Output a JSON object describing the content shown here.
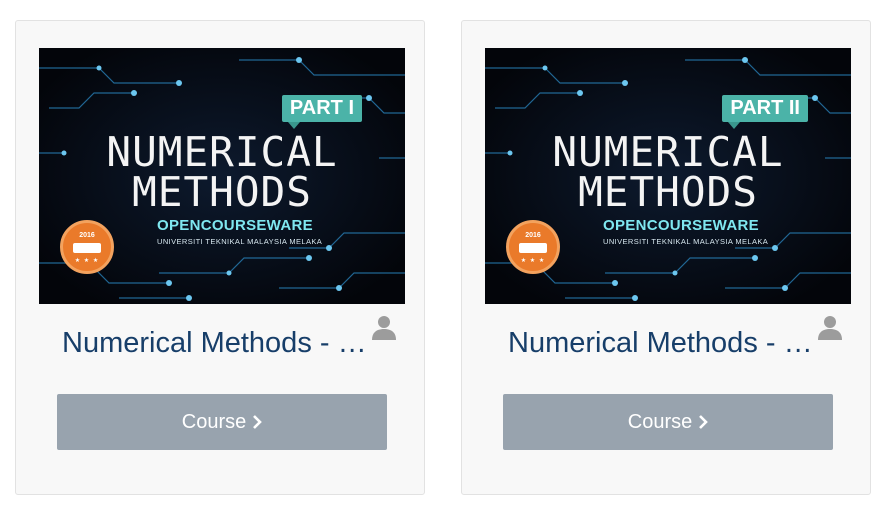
{
  "courses": [
    {
      "title": "Numerical Methods - Part I",
      "thumbnail": {
        "line1": "NUMERICAL",
        "line2": "METHODS",
        "part_tag": "PART I",
        "brand": "OPENCOURSEWARE",
        "university": "UNIVERSITI TEKNIKAL MALAYSIA MELAKA",
        "badge_year": "2016",
        "badge_stars": "★ ★ ★"
      },
      "button_label": "Course",
      "icons": {
        "author": "user-icon",
        "button": "chevron-right-icon"
      }
    },
    {
      "title": "Numerical Methods - Part II",
      "thumbnail": {
        "line1": "NUMERICAL",
        "line2": "METHODS",
        "part_tag": "PART II",
        "brand": "OPENCOURSEWARE",
        "university": "UNIVERSITI TEKNIKAL MALAYSIA MELAKA",
        "badge_year": "2016",
        "badge_stars": "★ ★ ★"
      },
      "button_label": "Course",
      "icons": {
        "author": "user-icon",
        "button": "chevron-right-icon"
      }
    }
  ],
  "colors": {
    "card_bg": "#f8f8f8",
    "title": "#173e69",
    "button_bg": "#98a3ae",
    "part_tag": "#4bb3a8",
    "badge": "#ea7a2a",
    "circuit": "#3aa0d8"
  }
}
